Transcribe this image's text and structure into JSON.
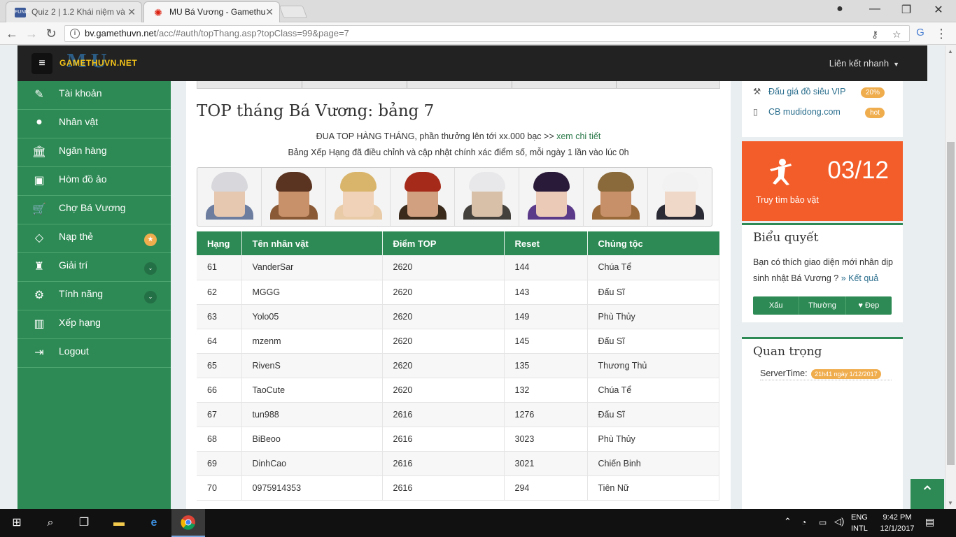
{
  "browser": {
    "tabs": [
      {
        "title": "Quiz 2 | 1.2 Khái niệm và",
        "favicon": "FUNIX"
      },
      {
        "title": "MU Bá Vương - Gamethu",
        "favicon": "mu-logo-icon"
      }
    ],
    "url_host": "bv.gamethuvn.net",
    "url_path": "/acc/#auth/topThang.asp?topClass=99&page=7"
  },
  "site": {
    "logo_text": "GAMETHUVN.NET",
    "logo_mu": "MU",
    "quick_links_label": "Liên kết nhanh"
  },
  "sidebar": {
    "items": [
      {
        "label": "Tài khoản",
        "icon": "edit-icon"
      },
      {
        "label": "Nhân vật",
        "icon": "user-icon"
      },
      {
        "label": "Ngân hàng",
        "icon": "bank-icon"
      },
      {
        "label": "Hòm đồ ảo",
        "icon": "briefcase-icon"
      },
      {
        "label": "Chợ Bá Vương",
        "icon": "cart-icon"
      },
      {
        "label": "Nạp thẻ",
        "icon": "diamond-icon",
        "badge": "★"
      },
      {
        "label": "Giải trí",
        "icon": "android-icon",
        "badge": "⌄"
      },
      {
        "label": "Tính năng",
        "icon": "gears-icon",
        "badge": "⌄"
      },
      {
        "label": "Xếp hạng",
        "icon": "bar-chart-icon"
      },
      {
        "label": "Logout",
        "icon": "sign-out-icon"
      }
    ]
  },
  "main": {
    "title": "TOP tháng Bá Vương: bảng 7",
    "notice1_text": "ĐUA TOP HÀNG THÁNG, phần thưởng lên tới xx.000 bạc >> ",
    "notice1_link": "xem chi tiết",
    "notice2": "Bảng Xếp Hạng đã điều chỉnh và cập nhật chính xác điểm số, mỗi ngày 1 lần vào lúc 0h",
    "table": {
      "headers": [
        "Hạng",
        "Tên nhân vật",
        "Điểm TOP",
        "Reset",
        "Chủng tộc"
      ],
      "rows": [
        {
          "rank": "61",
          "name": "VanderSar",
          "score": "2620",
          "reset": "144",
          "race": "Chúa Tể"
        },
        {
          "rank": "62",
          "name": "MGGG",
          "score": "2620",
          "reset": "143",
          "race": "Đấu Sĩ"
        },
        {
          "rank": "63",
          "name": "Yolo05",
          "score": "2620",
          "reset": "149",
          "race": "Phù Thủy"
        },
        {
          "rank": "64",
          "name": "mzenm",
          "score": "2620",
          "reset": "145",
          "race": "Đấu Sĩ"
        },
        {
          "rank": "65",
          "name": "RivenS",
          "score": "2620",
          "reset": "135",
          "race": "Thương Thủ"
        },
        {
          "rank": "66",
          "name": "TaoCute",
          "score": "2620",
          "reset": "132",
          "race": "Chúa Tể"
        },
        {
          "rank": "67",
          "name": "tun988",
          "score": "2616",
          "reset": "1276",
          "race": "Đấu Sĩ"
        },
        {
          "rank": "68",
          "name": "BiBeoo",
          "score": "2616",
          "reset": "3023",
          "race": "Phù Thủy"
        },
        {
          "rank": "69",
          "name": "DinhCao",
          "score": "2616",
          "reset": "3021",
          "race": "Chiến Binh"
        },
        {
          "rank": "70",
          "name": "0975914353",
          "score": "2616",
          "reset": "294",
          "race": "Tiên Nữ"
        }
      ]
    }
  },
  "right": {
    "link1": "Đấu giá đồ siêu VIP",
    "link1_pill": "20%",
    "link2": "CB mudidong.com",
    "link2_pill": "hot",
    "date": "03/12",
    "treasure": "Truy tìm bảo vật",
    "poll_title": "Biểu quyết",
    "poll_text": "Bạn có thích giao diện mới nhân dịp sinh nhật Bá Vương ?",
    "poll_result": "» Kết quả",
    "vote_bad": "Xấu",
    "vote_normal": "Thường",
    "vote_good": "♥ Đẹp",
    "important_title": "Quan trọng",
    "server_label": "ServerTime:",
    "server_value": "21h41 ngày 1/12/2017"
  },
  "taskbar": {
    "lang": "ENG",
    "lang2": "INTL",
    "time": "9:42 PM",
    "date": "12/1/2017"
  },
  "colors": {
    "green": "#2d8a54",
    "orange": "#f35d2a",
    "badge": "#f0ad4e"
  }
}
